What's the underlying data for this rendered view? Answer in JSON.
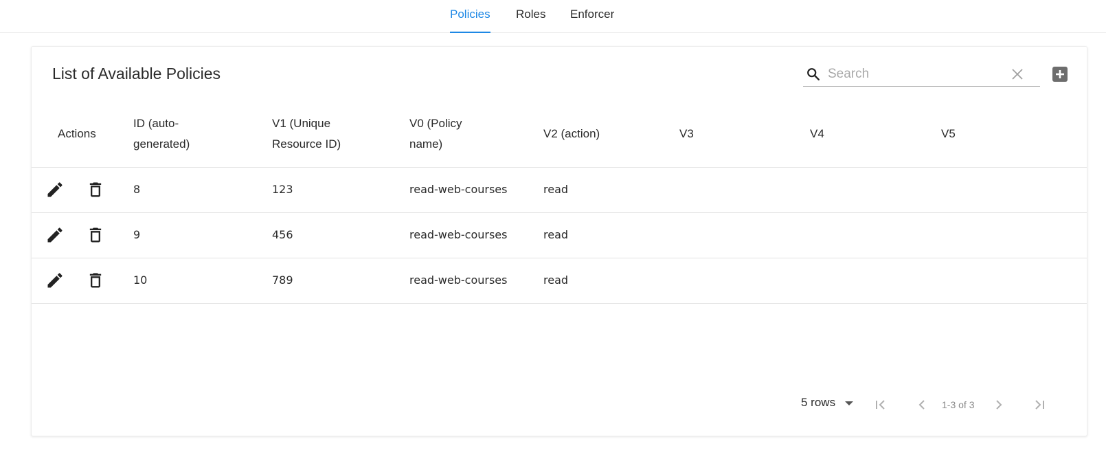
{
  "nav": {
    "tabs": [
      {
        "label": "Policies",
        "active": true
      },
      {
        "label": "Roles",
        "active": false
      },
      {
        "label": "Enforcer",
        "active": false
      }
    ],
    "accent_color": "#1e88e5"
  },
  "card": {
    "title": "List of Available Policies",
    "search": {
      "placeholder": "Search",
      "value": ""
    },
    "add_icon": "add-box-icon"
  },
  "table": {
    "headers": {
      "actions": "Actions",
      "id_1": "ID (auto-",
      "id_2": "generated)",
      "v1_1": "V1 (Unique",
      "v1_2": "Resource ID)",
      "v0_1": "V0 (Policy",
      "v0_2": "name)",
      "v2": "V2 (action)",
      "v3": "V3",
      "v4": "V4",
      "v5": "V5"
    },
    "rows": [
      {
        "id": "8",
        "v1": "123",
        "v0": "read-web-courses",
        "v2": "read",
        "v3": "",
        "v4": "",
        "v5": ""
      },
      {
        "id": "9",
        "v1": "456",
        "v0": "read-web-courses",
        "v2": "read",
        "v3": "",
        "v4": "",
        "v5": ""
      },
      {
        "id": "10",
        "v1": "789",
        "v0": "read-web-courses",
        "v2": "read",
        "v3": "",
        "v4": "",
        "v5": ""
      }
    ]
  },
  "pagination": {
    "rows_per_page": "5 rows",
    "range": "1-3 of 3"
  }
}
